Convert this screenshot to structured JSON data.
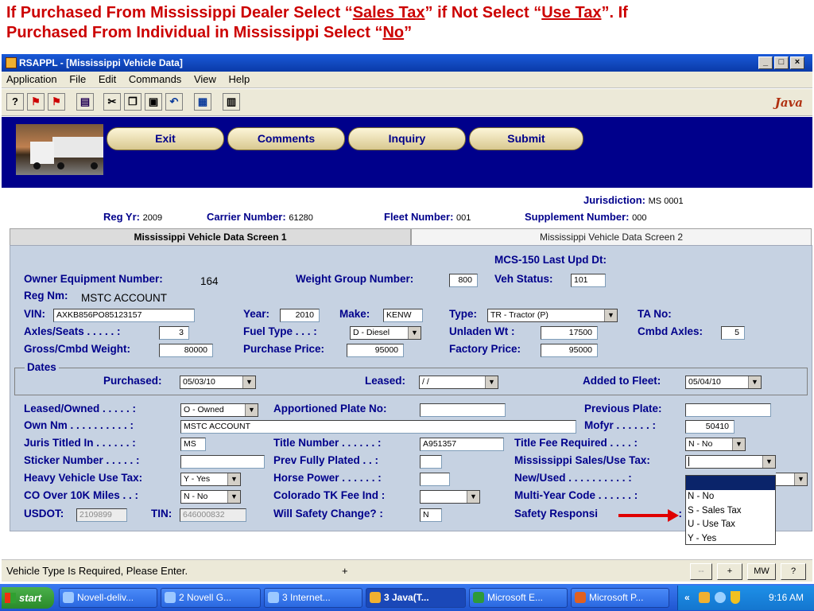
{
  "caption": {
    "line1_a": "If Purchased From Mississippi Dealer Select “",
    "line1_b": "Sales Tax",
    "line1_c": "” if Not Select “",
    "line1_d": "Use Tax",
    "line1_e": "”. If",
    "line2_a": "Purchased From Individual in Mississippi Select “",
    "line2_b": "No",
    "line2_c": "”"
  },
  "window": {
    "title": "RSAPPL - [Mississippi Vehicle Data]",
    "min": "_",
    "max": "□",
    "close": "×"
  },
  "menu": [
    "Application",
    "File",
    "Edit",
    "Commands",
    "View",
    "Help"
  ],
  "toolbar": {
    "icons": [
      "help-icon",
      "exit-app-icon",
      "flag-icon",
      "print-icon",
      "cut-icon",
      "copy-icon",
      "paste-icon",
      "undo-icon",
      "save-icon",
      "calculator-icon"
    ],
    "brand": "Java"
  },
  "nav": {
    "exit": "Exit",
    "comments": "Comments",
    "inquiry": "Inquiry",
    "submit": "Submit"
  },
  "info": {
    "jurisdiction_label": "Jurisdiction:",
    "jurisdiction_value": "MS  0001",
    "regyr_label": "Reg Yr:",
    "regyr_value": "2009",
    "carrier_label": "Carrier Number:",
    "carrier_value": "61280",
    "fleet_label": "Fleet Number:",
    "fleet_value": "001",
    "supp_label": "Supplement Number:",
    "supp_value": "000"
  },
  "tabs": {
    "tab1": "Mississippi Vehicle Data Screen 1",
    "tab2": "Mississippi Vehicle Data Screen 2"
  },
  "form": {
    "mcs_label": "MCS-150 Last Upd Dt:",
    "owner_eq_label": "Owner Equipment Number:",
    "owner_eq_value": "164",
    "weight_group_label": "Weight Group Number:",
    "weight_group_value": "800",
    "veh_status_label": "Veh Status:",
    "veh_status_value": "101",
    "regnm_label": "Reg Nm:",
    "regnm_value": "MSTC ACCOUNT",
    "vin_label": "VIN:",
    "vin_value": "AXKB856PO85123157",
    "year_label": "Year:",
    "year_value": "2010",
    "make_label": "Make:",
    "make_value": "KENW",
    "type_label": "Type:",
    "type_value": "TR - Tractor (P)",
    "tano_label": "TA No:",
    "axles_label": "Axles/Seats  . . . . . :",
    "axles_value": "3",
    "fuel_label": "Fuel Type  . . . :",
    "fuel_value": "D - Diesel",
    "unladen_label": "Unladen Wt  :",
    "unladen_value": "17500",
    "cmbd_axles_label": "Cmbd Axles:",
    "cmbd_axles_value": "5",
    "gross_label": "Gross/Cmbd Weight:",
    "gross_value": "80000",
    "purchase_label": "Purchase Price:",
    "purchase_value": "95000",
    "factory_label": "Factory Price:",
    "factory_value": "95000",
    "dates_title": "Dates",
    "purchased_label": "Purchased:",
    "purchased_value": "05/03/10",
    "leased_label": "Leased:",
    "leased_value": " / /",
    "added_label": "Added to Fleet:",
    "added_value": "05/04/10",
    "leased_owned_label": "Leased/Owned  . . . . . :",
    "leased_owned_value": "O - Owned",
    "apport_label": "Apportioned Plate No:",
    "apport_value": "",
    "prev_plate_label": "Previous Plate:",
    "prev_plate_value": "",
    "own_nm_label": "Own Nm  . . . . . . . . . . :",
    "own_nm_value": "MSTC ACCOUNT",
    "mofyr_label": "Mofyr  . . . . . . :",
    "mofyr_value": "50410",
    "juris_label": "Juris Titled In  . . . . . . :",
    "juris_value": "MS",
    "title_num_label": "Title Number  . . . . . . :",
    "title_num_value": "A951357",
    "title_fee_label": "Title Fee Required  . . . . :",
    "title_fee_value": "N - No",
    "sticker_label": "Sticker Number  . . . . . :",
    "sticker_value": "",
    "prev_fully_label": "Prev Fully Plated  . . :",
    "prev_fully_value": "",
    "ms_sales_label": "Mississippi Sales/Use Tax:",
    "ms_sales_value": "",
    "hvut_label": "Heavy Vehicle Use Tax:",
    "hvut_value": "Y - Yes",
    "horse_label": "Horse Power  . . . . . . :",
    "horse_value": "",
    "newused_label": "New/Used  . . . . . . . . . . :",
    "co_label": "CO Over 10K Miles  . . :",
    "co_value": "N - No",
    "colorado_label": "Colorado TK Fee Ind :",
    "colorado_value": "",
    "multiyear_label": "Multi-Year Code  . . . . . . :",
    "usdot_label": "USDOT:",
    "usdot_value": "2109899",
    "tin_label": "TIN:",
    "tin_value": "646000832",
    "safety_change_label": "Will Safety Change? :",
    "safety_change_value": "N",
    "safety_resp_label": "Safety Responsi",
    "safety_resp_tail": ". :"
  },
  "dropdown_options": [
    "N - No",
    "S - Sales Tax",
    "U - Use Tax",
    "Y - Yes"
  ],
  "status": {
    "message": "Vehicle Type Is Required, Please Enter.",
    "marker": "+",
    "btn1": "--",
    "btn2": "+",
    "btn3": "MW",
    "btn4": "?"
  },
  "taskbar": {
    "start": "start",
    "tasks": [
      "Novell-deliv...",
      "2 Novell G...",
      "3 Internet...",
      "3 Java(T...",
      "Microsoft E...",
      "Microsoft P..."
    ],
    "tray_chevron": "«",
    "clock": "9:16 AM"
  }
}
